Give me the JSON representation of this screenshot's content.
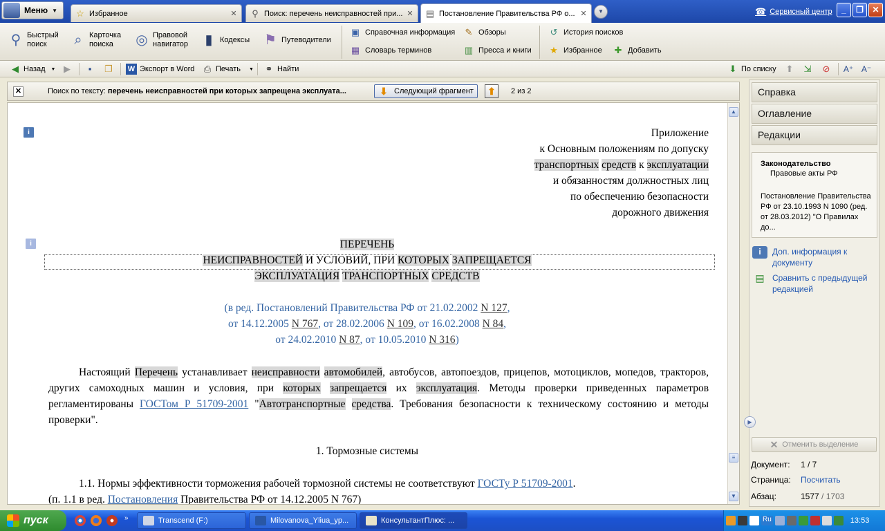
{
  "tabbar": {
    "menu_label": "Меню",
    "tabs": [
      {
        "label": "Избранное"
      },
      {
        "label": "Поиск: перечень неисправностей при..."
      },
      {
        "label": "Постановление Правительства РФ о..."
      }
    ],
    "service_label": "Сервисный центр",
    "win_buttons": [
      "_",
      "❐",
      "✕"
    ]
  },
  "ribbon": {
    "big": [
      {
        "l1": "Быстрый",
        "l2": "поиск"
      },
      {
        "l1": "Карточка",
        "l2": "поиска"
      },
      {
        "l1": "Правовой",
        "l2": "навигатор"
      },
      {
        "l1": "Кодексы",
        "l2": ""
      },
      {
        "l1": "Путеводители",
        "l2": ""
      }
    ],
    "small": [
      {
        "label": "Справочная информация"
      },
      {
        "label": "Словарь терминов"
      },
      {
        "label": "Обзоры"
      },
      {
        "label": "Пресса и книги"
      },
      {
        "label": "История поисков"
      },
      {
        "label": "Избранное"
      },
      {
        "label": "Добавить"
      }
    ]
  },
  "toolbar": {
    "back": "Назад",
    "export": "Экспорт в Word",
    "print": "Печать",
    "find": "Найти",
    "by_list": "По списку"
  },
  "searchbar": {
    "prefix": "Поиск по тексту: ",
    "query": "перечень неисправностей при которых запрещена эксплуата...",
    "next": "Следующий фрагмент",
    "count": "2 из 2"
  },
  "doc": {
    "appendix": [
      [
        "Приложение"
      ],
      [
        "к Основным положениям по допуску"
      ],
      [
        "транспортных",
        " ",
        "средств",
        " к ",
        "эксплуатации"
      ],
      [
        "и обязанностям должностных лиц"
      ],
      [
        "по обеспечению безопасности"
      ],
      [
        "дорожного движения"
      ]
    ],
    "title1": "ПЕРЕЧЕНЬ",
    "title2": [
      "НЕИСПРАВНОСТЕЙ",
      " И УСЛОВИЙ, ПРИ ",
      "КОТОРЫХ",
      " ",
      "ЗАПРЕЩАЕТСЯ"
    ],
    "title3": [
      "ЭКСПЛУАТАЦИЯ",
      " ",
      "ТРАНСПОРТНЫХ",
      " ",
      "СРЕДСТВ"
    ],
    "red1": {
      "a": "(в ред. Постановлений Правительства РФ от 21.02.2002 ",
      "b": "N 127",
      "c": ","
    },
    "red2": {
      "a": "от 14.12.2005 ",
      "b": "N 767",
      "c": ", от 28.02.2006 ",
      "d": "N 109",
      "e": ", от 16.02.2008 ",
      "f": "N 84",
      "g": ","
    },
    "red3": {
      "a": "от 24.02.2010 ",
      "b": "N 87",
      "c": ", от 10.05.2010 ",
      "d": "N 316",
      "e": ")"
    },
    "para1": {
      "t1": "Настоящий ",
      "h1": "Перечень",
      "t2": " устанавливает ",
      "h2": "неисправности",
      "t3": " ",
      "h3": "автомобилей",
      "t4": ", автобусов, автопоездов, прицепов, мотоциклов, мопедов, тракторов, других самоходных машин и условия, при ",
      "h4": "которых",
      "t5": " ",
      "h5": "запрещается",
      "t6": " их ",
      "h6": "эксплуатация",
      "t7": ". Методы проверки приведенных параметров регламентированы ",
      "l1": "ГОСТом Р 51709-2001",
      "t8": " \"",
      "h7": "Автотранспортные",
      "t9": " ",
      "h8": "средства",
      "t10": ". Требования безопасности к техническому состоянию и методы проверки\"."
    },
    "section1": "1. Тормозные системы",
    "item11": {
      "a": "1.1. Нормы эффективности торможения рабочей тормозной системы не соответствуют ",
      "b": "ГОСТу Р 51709-2001",
      "c": "."
    },
    "item11b": {
      "a": "(п. 1.1 в ред. ",
      "b": "Постановления",
      "c": " Правительства РФ от 14.12.2005 N 767)"
    }
  },
  "rpanel": {
    "tabs": [
      "Справка",
      "Оглавление",
      "Редакции"
    ],
    "card_h1": "Законодательство",
    "card_h2": "Правовые акты РФ",
    "card_body": "Постановление Правительства РФ от 23.10.1993 N 1090 (ред. от 28.03.2012) \"О Правилах до...",
    "link1": "Доп. информация к документу",
    "link2": "Сравнить с предыдущей редакцией",
    "cancel": "Отменить выделение",
    "doc_label": "Документ:",
    "doc_val": "1 / 7",
    "page_label": "Страница:",
    "page_val": "Посчитать",
    "para_label": "Абзац:",
    "para_val": "1577",
    "para_total": "/ 1703"
  },
  "taskbar": {
    "start": "пуск",
    "tasks": [
      "Transcend (F:)",
      "Milovanova_Yliua_yp...",
      "КонсультантПлюс: ..."
    ],
    "clock": "13:53",
    "lang": "Ru"
  }
}
